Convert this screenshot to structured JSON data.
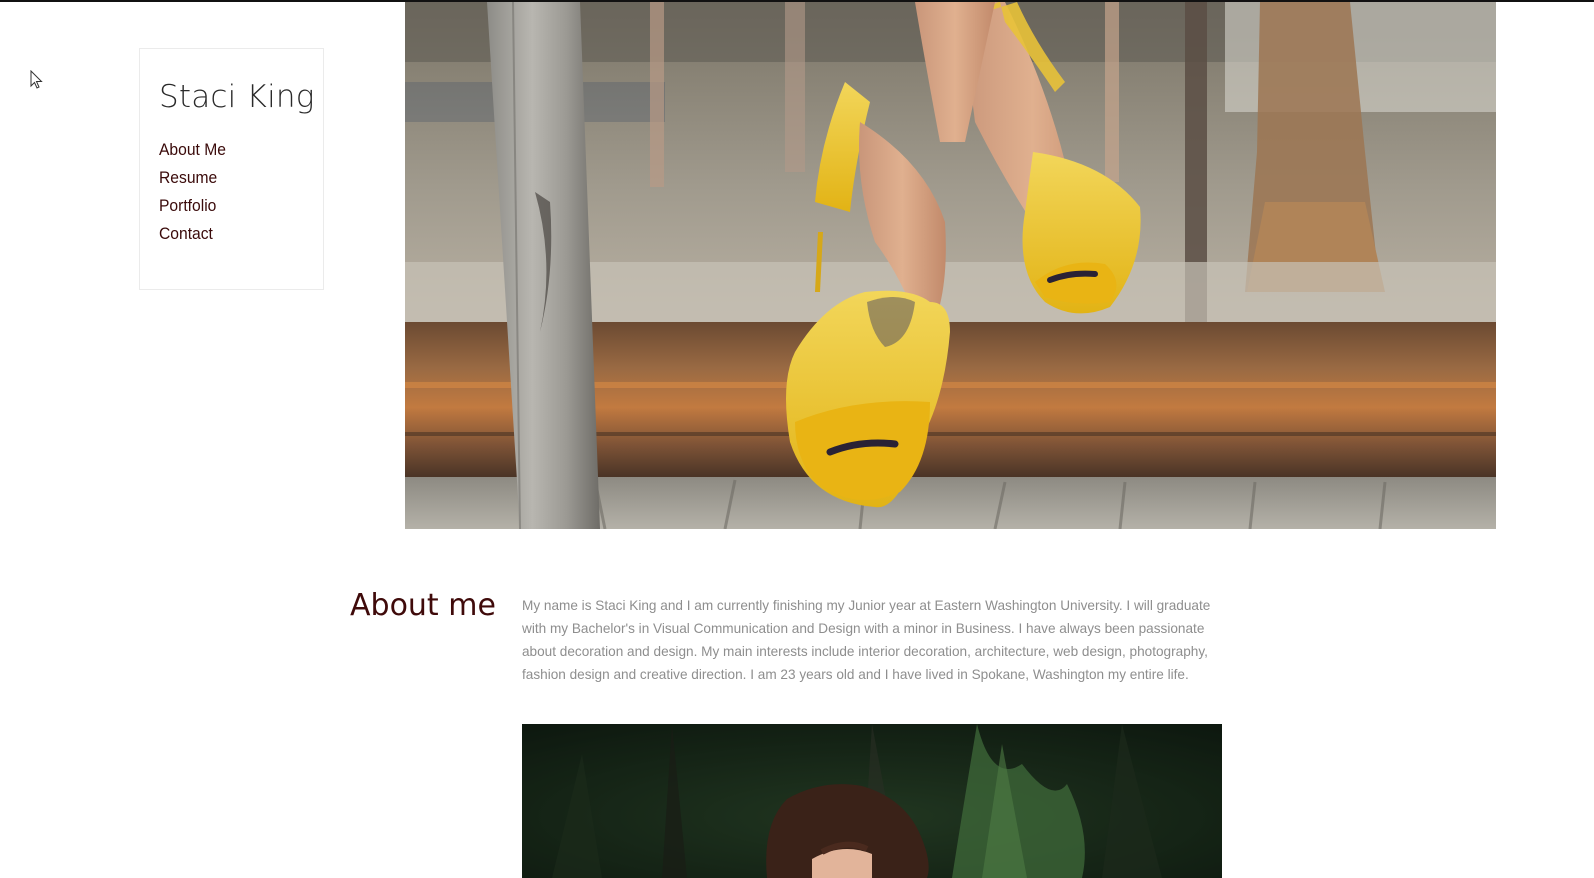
{
  "site": {
    "title": "Staci King"
  },
  "nav": {
    "items": [
      {
        "label": "About Me"
      },
      {
        "label": "Resume"
      },
      {
        "label": "Portfolio"
      },
      {
        "label": "Contact"
      }
    ]
  },
  "hero_image": {
    "icon": "photo-yellow-high-heels"
  },
  "about": {
    "heading": "About me",
    "body": "My name is Staci King and I am currently finishing my Junior year at Eastern Washington University. I will graduate with my Bachelor's in Visual Communication and Design with a minor in Business. I have always been passionate about decoration and design. My main interests include interior decoration, architecture, web design, photography, fashion design and creative direction. I am 23 years old and I have lived in Spokane, Washington my entire life."
  },
  "portrait_image": {
    "icon": "photo-portrait-forest"
  },
  "colors": {
    "accent": "#3f0a0a",
    "body_text": "#8e8e8e",
    "nav_border": "#ebebeb"
  }
}
